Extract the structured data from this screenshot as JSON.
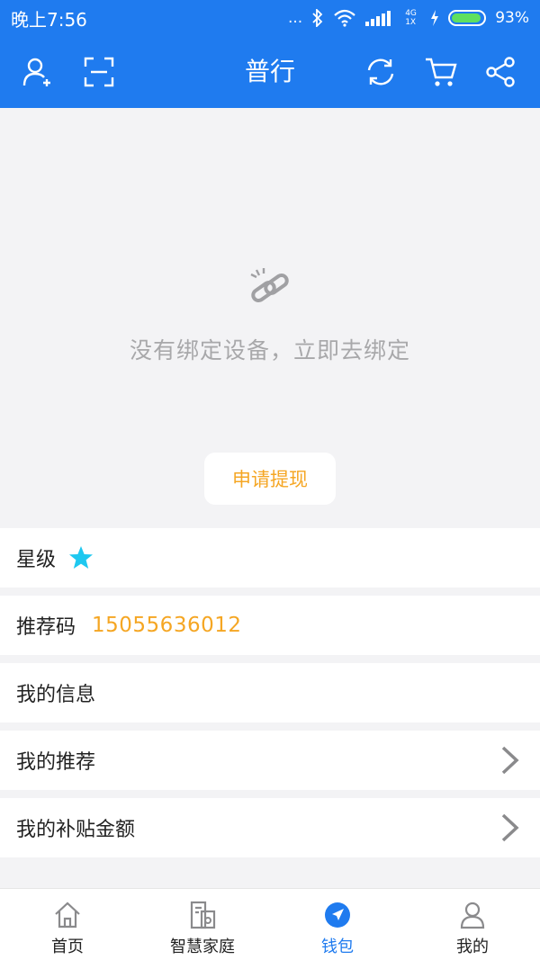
{
  "status_bar": {
    "time": "晚上7:56",
    "dots": "...",
    "network": "4G 1X",
    "battery_percent": "93%",
    "battery_level": 0.93
  },
  "header": {
    "title": "普行",
    "icons": [
      "add-user-icon",
      "scan-icon",
      "refresh-icon",
      "cart-icon",
      "share-icon"
    ]
  },
  "empty_state": {
    "icon": "broken-link-icon",
    "message": "没有绑定设备，立即去绑定",
    "button_label": "申请提现"
  },
  "list": {
    "rating_label": "星级",
    "rating_stars": 1,
    "referral_label": "推荐码",
    "referral_code": "15055636012",
    "my_info_label": "我的信息",
    "my_referrals_label": "我的推荐",
    "my_subsidy_label": "我的补贴金额"
  },
  "tabs": [
    {
      "label": "首页",
      "icon": "home-icon",
      "active": false
    },
    {
      "label": "智慧家庭",
      "icon": "smart-home-icon",
      "active": false
    },
    {
      "label": "钱包",
      "icon": "wallet-navigation-icon",
      "active": true
    },
    {
      "label": "我的",
      "icon": "profile-icon",
      "active": false
    }
  ],
  "colors": {
    "primary": "#1f7bef",
    "accent_orange": "#f5a623",
    "star": "#1ec8f0",
    "background": "#f3f3f5"
  }
}
